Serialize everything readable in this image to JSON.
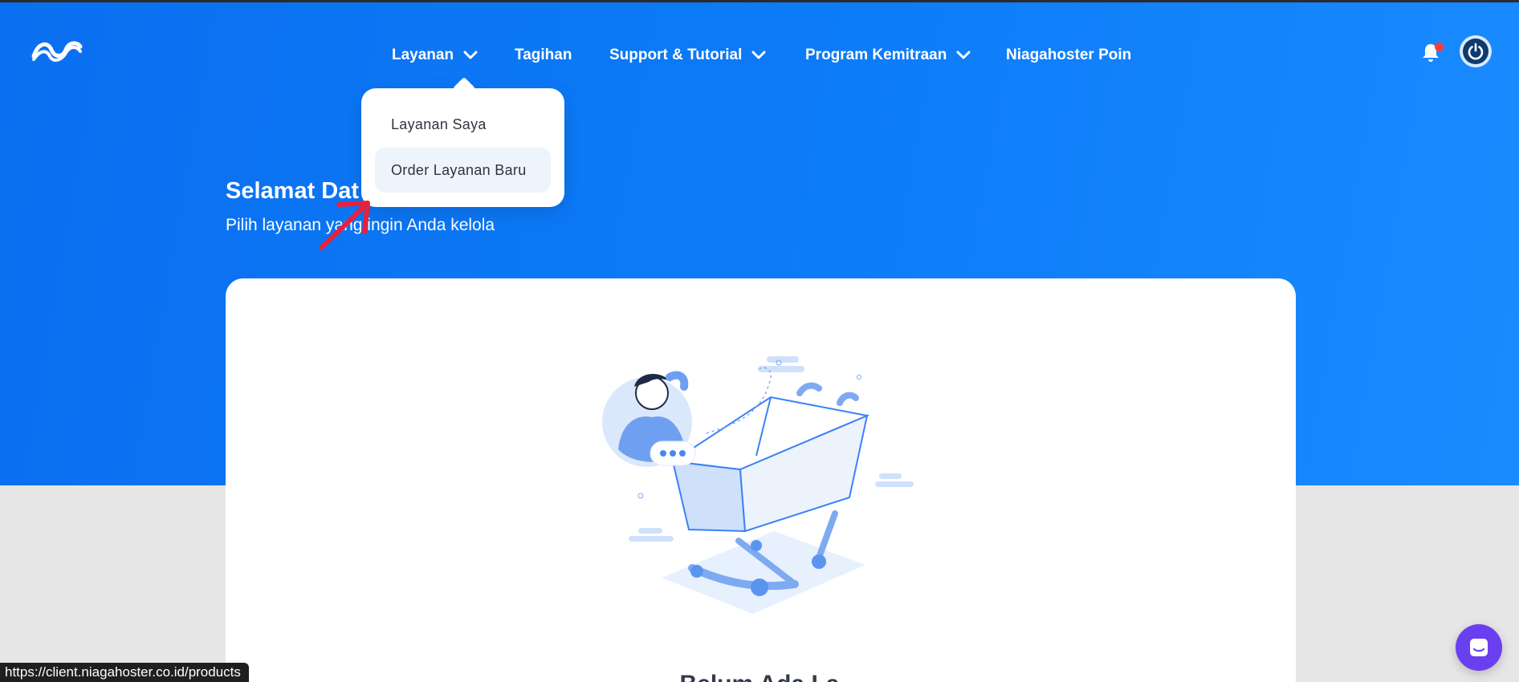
{
  "nav": {
    "items": [
      {
        "label": "Layanan",
        "has_dropdown": true
      },
      {
        "label": "Tagihan",
        "has_dropdown": false
      },
      {
        "label": "Support & Tutorial",
        "has_dropdown": true
      },
      {
        "label": "Program Kemitraan",
        "has_dropdown": true
      },
      {
        "label": "Niagahoster Poin",
        "has_dropdown": false
      }
    ]
  },
  "dropdown": {
    "items": [
      {
        "label": "Layanan Saya"
      },
      {
        "label": "Order Layanan Baru",
        "highlighted": true
      }
    ]
  },
  "hero": {
    "title": "Selamat Dat",
    "subtitle": "Pilih layanan yang ingin Anda kelola"
  },
  "card": {
    "title": "Belum Ada La"
  },
  "statusbar": {
    "url": "https://client.niagahoster.co.id/products"
  },
  "icons": {
    "logo": "niagahoster-logo",
    "bell": "bell-icon",
    "power": "power-icon",
    "chat": "chat-icon",
    "chevron": "chevron-down-icon"
  },
  "colors": {
    "hero_blue": "#0d7cf8",
    "notification_dot": "#ff3b3b",
    "chat_purple": "#6a3ff0",
    "annotation_red": "#e8213a"
  }
}
